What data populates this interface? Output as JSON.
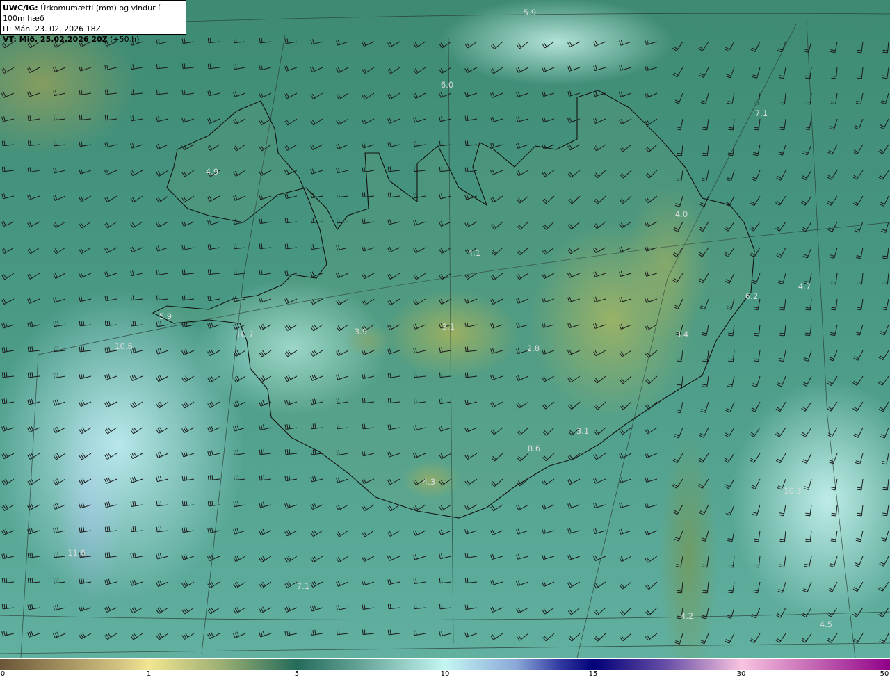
{
  "header": {
    "model": "UWC/IG:",
    "title": "Úrkomumætti (mm) og vindur í 100m hæð",
    "init_time": "IT: Mán. 23. 02. 2026 18Z",
    "valid_label": "VT: Mið. 25.02.2026 20Z",
    "lead": "(+50 h)"
  },
  "map_labels": [
    "5.9",
    "6.0",
    "7.1",
    "4.9",
    "4.0",
    "4.1",
    "4.7",
    "6.2",
    "5.9",
    "3.9",
    "3.1",
    "3.4",
    "2.8",
    "10.6",
    "10.7",
    "3.1",
    "8.6",
    "4.3",
    "10.3",
    "11.6",
    "7.1",
    "4.2",
    "4.5"
  ],
  "colorbar": {
    "unit": "mm",
    "ticks": [
      "0",
      "1",
      "5",
      "10",
      "15",
      "30",
      "50"
    ],
    "colors": [
      "#6a5638",
      "#f2e690",
      "#246b5a",
      "#c4f6f2",
      "#000078",
      "#f8c4e0",
      "#900088"
    ]
  }
}
